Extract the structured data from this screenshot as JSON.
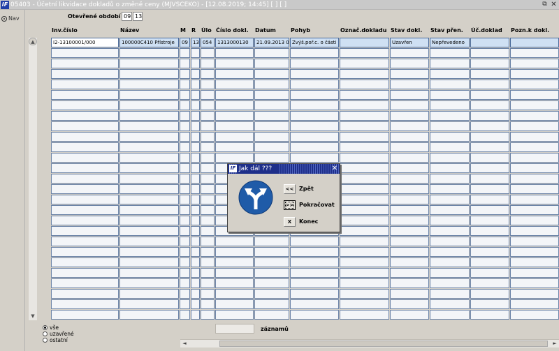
{
  "window": {
    "title": "05403 - Účetní likvidace dokladů o změně ceny (MJVSCEKO) - [12.08.2019; 14:45]  [ ] [ ]",
    "restore_glyph": "⧉",
    "close_glyph": "✕",
    "app_icon_text": "IF"
  },
  "nav": {
    "label": "Nav"
  },
  "period": {
    "label": "Otevřené období",
    "month": "09",
    "year": "13"
  },
  "table": {
    "columns": [
      "Inv.číslo",
      "Název",
      "M",
      "R",
      "Úlo",
      "Číslo dokl.",
      "Datum",
      "Pohyb",
      "Označ.dokladu",
      "Stav dokl.",
      "Stav přen.",
      "Úč.doklad",
      "Pozn.k dokl."
    ],
    "rows": [
      [
        "I2-13100001/000",
        "100000C410 Přístroje",
        "09",
        "13",
        "054",
        "1313000130",
        "21.09.2013 0",
        "Zvýš.poř.c. o části",
        "",
        "Uzavřen",
        "Nepřevedeno",
        "",
        ""
      ]
    ],
    "visible_row_count": 27,
    "scroll_up": "▲",
    "scroll_down": "▼"
  },
  "filter": {
    "options": [
      {
        "label": "vše",
        "selected": true
      },
      {
        "label": "uzavřené",
        "selected": false
      },
      {
        "label": "ostatní",
        "selected": false
      }
    ]
  },
  "records": {
    "label": "záznamů",
    "count": ""
  },
  "hscroll": {
    "left": "◄",
    "right": "►"
  },
  "dialog": {
    "title": "Jak dál ???",
    "icon_text": "IF",
    "close_glyph": "✕",
    "sign_icon": "fork-arrows-icon",
    "buttons": [
      {
        "key": "<<",
        "label": "Zpět",
        "focused": false
      },
      {
        "key": ">>",
        "label": "Pokračovat",
        "focused": true
      },
      {
        "key": "X",
        "label": "Konec",
        "focused": false
      }
    ]
  },
  "colors": {
    "cell_border": "#6c84a8",
    "selected_row": "#cfe0f3",
    "dialog_title": "#1e2f8a",
    "sign_blue": "#1f5ba8"
  }
}
